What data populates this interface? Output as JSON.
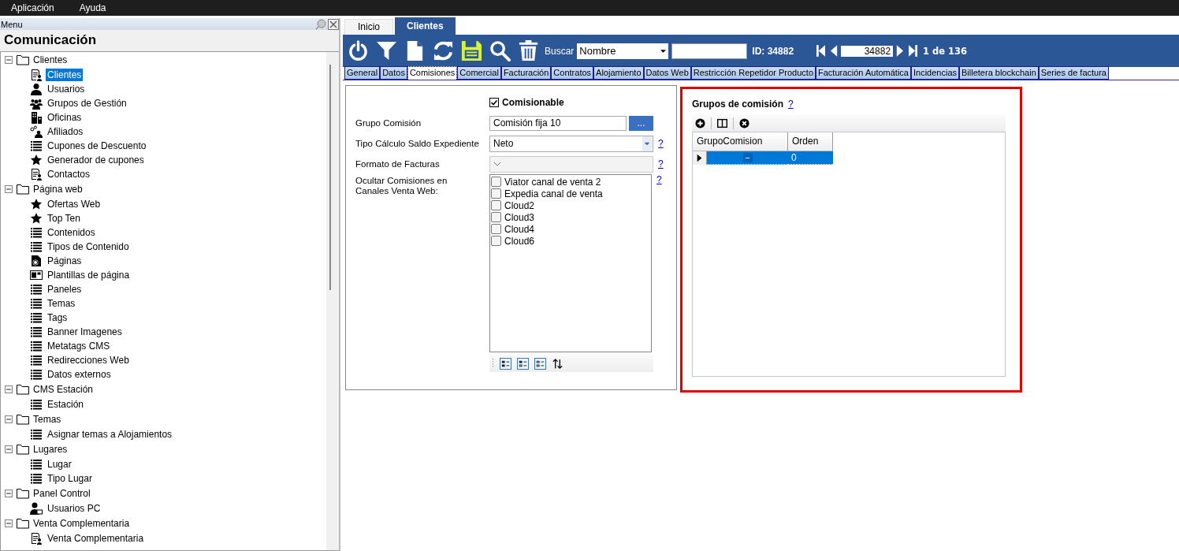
{
  "menu_bar": [
    "Aplicación",
    "Ayuda"
  ],
  "sidebar": {
    "title": "Menu",
    "heading": "Comunicación",
    "tree": [
      {
        "label": "Clientes",
        "expanded": true,
        "children": [
          {
            "label": "Clientes",
            "kind": "doc-user",
            "selected": true
          },
          {
            "label": "Usuarios",
            "kind": "user",
            "selected": false
          },
          {
            "label": "Grupos de Gestión",
            "kind": "group",
            "selected": false
          },
          {
            "label": "Oficinas",
            "kind": "building",
            "selected": false
          },
          {
            "label": "Afiliados",
            "kind": "affiliate",
            "selected": false
          },
          {
            "label": "Cupones de Descuento",
            "kind": "list",
            "selected": false
          },
          {
            "label": "Generador de cupones",
            "kind": "star",
            "selected": false
          },
          {
            "label": "Contactos",
            "kind": "doc-user",
            "selected": false
          }
        ]
      },
      {
        "label": "Página web",
        "expanded": true,
        "children": [
          {
            "label": "Ofertas Web",
            "kind": "star",
            "selected": false
          },
          {
            "label": "Top Ten",
            "kind": "star",
            "selected": false
          },
          {
            "label": "Contenidos",
            "kind": "list",
            "selected": false
          },
          {
            "label": "Tipos de Contenido",
            "kind": "list",
            "selected": false
          },
          {
            "label": "Páginas",
            "kind": "page",
            "selected": false
          },
          {
            "label": "Plantillas de página",
            "kind": "template",
            "selected": false
          },
          {
            "label": "Paneles",
            "kind": "list",
            "selected": false
          },
          {
            "label": "Temas",
            "kind": "list",
            "selected": false
          },
          {
            "label": "Tags",
            "kind": "list",
            "selected": false
          },
          {
            "label": "Banner Imagenes",
            "kind": "list",
            "selected": false
          },
          {
            "label": "Metatags CMS",
            "kind": "list",
            "selected": false
          },
          {
            "label": "Redirecciones Web",
            "kind": "list",
            "selected": false
          },
          {
            "label": "Datos externos",
            "kind": "list",
            "selected": false
          }
        ]
      },
      {
        "label": "CMS Estación",
        "expanded": true,
        "children": [
          {
            "label": "Estación",
            "kind": "list",
            "selected": false
          }
        ]
      },
      {
        "label": "Temas",
        "expanded": true,
        "children": [
          {
            "label": "Asignar temas a Alojamientos",
            "kind": "list",
            "selected": false
          }
        ]
      },
      {
        "label": "Lugares",
        "expanded": true,
        "children": [
          {
            "label": "Lugar",
            "kind": "list",
            "selected": false
          },
          {
            "label": "Tipo Lugar",
            "kind": "list",
            "selected": false
          }
        ]
      },
      {
        "label": "Panel Control",
        "expanded": true,
        "children": [
          {
            "label": "Usuarios PC",
            "kind": "user-pc",
            "selected": false
          }
        ]
      },
      {
        "label": "Venta Complementaria",
        "expanded": true,
        "children": [
          {
            "label": "Venta Complementaria",
            "kind": "doc-user",
            "selected": false
          }
        ]
      }
    ]
  },
  "tabs": [
    {
      "label": "Inicio",
      "selected": false
    },
    {
      "label": "Clientes",
      "selected": true
    }
  ],
  "toolbar": {
    "search_label": "Buscar",
    "search_by": "Nombre",
    "id": "ID: 34882",
    "record": "34882",
    "count": "1 de 136"
  },
  "subtabs": [
    {
      "label": "General",
      "selected": false
    },
    {
      "label": "Datos",
      "selected": false
    },
    {
      "label": "Comisiones",
      "selected": true
    },
    {
      "label": "Comercial",
      "selected": false
    },
    {
      "label": "Facturación",
      "selected": false
    },
    {
      "label": "Contratos",
      "selected": false
    },
    {
      "label": "Alojamiento",
      "selected": false
    },
    {
      "label": "Datos Web",
      "selected": false
    },
    {
      "label": "Restricción Repetidor Producto",
      "selected": false
    },
    {
      "label": "Facturación Automática",
      "selected": false
    },
    {
      "label": "Incidencias",
      "selected": false
    },
    {
      "label": "Billetera blockchain",
      "selected": false
    },
    {
      "label": "Series de factura",
      "selected": false
    }
  ],
  "form": {
    "comisionable": {
      "label": "Comisionable",
      "checked": true
    },
    "grupo": {
      "label": "Grupo Comisión",
      "value": "Comisión fija 10",
      "button": "..."
    },
    "tipo_calculo": {
      "label": "Tipo Cálculo Saldo Expediente",
      "value": "Neto",
      "help": "?"
    },
    "formato_facturas": {
      "label": "Formato de Facturas",
      "disabled": true,
      "help": "?"
    },
    "ocultar": {
      "label": "Ocultar Comisiones en Canales Venta Web:",
      "help": "?",
      "items": [
        {
          "label": "Viator canal de venta 2",
          "checked": false
        },
        {
          "label": "Expedia canal de venta",
          "checked": false
        },
        {
          "label": "Cloud2",
          "checked": false
        },
        {
          "label": "Cloud3",
          "checked": false
        },
        {
          "label": "Cloud4",
          "checked": false
        },
        {
          "label": "Cloud6",
          "checked": false
        }
      ]
    }
  },
  "grupos_panel": {
    "title": "Grupos de comisión",
    "help": "?",
    "highlighted": true,
    "columns": [
      "GrupoComision",
      "Orden"
    ],
    "rows": [
      {
        "cells": [
          "−",
          "0"
        ],
        "selected": true
      }
    ]
  }
}
